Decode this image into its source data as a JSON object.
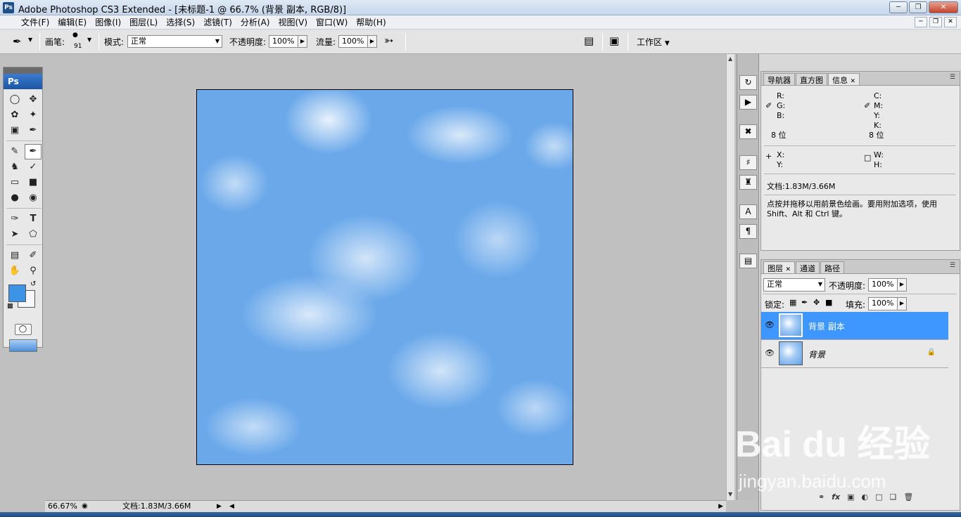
{
  "window": {
    "title": "Adobe Photoshop CS3 Extended - [未标题-1 @ 66.7% (背景 副本, RGB/8)]",
    "logo": "Ps"
  },
  "menu": {
    "items": [
      "文件(F)",
      "编辑(E)",
      "图像(I)",
      "图层(L)",
      "选择(S)",
      "滤镜(T)",
      "分析(A)",
      "视图(V)",
      "窗口(W)",
      "帮助(H)"
    ]
  },
  "options": {
    "brush_label": "画笔:",
    "brush_size": "91",
    "mode_label": "模式:",
    "mode_value": "正常",
    "opacity_label": "不透明度:",
    "opacity_value": "100%",
    "flow_label": "流量:",
    "flow_value": "100%",
    "workspace_label": "工作区"
  },
  "toolbox": {
    "logo": "Ps",
    "foreground_color": "#3e94e4",
    "background_color": "#f5f7fa"
  },
  "status": {
    "zoom": "66.67%",
    "doc_info": "文档:1.83M/3.66M"
  },
  "info_panel": {
    "tabs": [
      "导航器",
      "直方图",
      "信息"
    ],
    "active_tab": "信息",
    "r": "R:",
    "g": "G:",
    "b": "B:",
    "c": "C:",
    "m": "M:",
    "y": "Y:",
    "k": "K:",
    "bits_left": "8 位",
    "bits_right": "8 位",
    "x": "X:",
    "yy": "Y:",
    "w": "W:",
    "h": "H:",
    "doc": "文档:1.83M/3.66M",
    "hint": "点按并拖移以用前景色绘画。要用附加选项，使用 Shift、Alt 和 Ctrl 键。"
  },
  "layers_panel": {
    "tabs": [
      "图层",
      "通道",
      "路径"
    ],
    "active_tab": "图层",
    "blend_mode": "正常",
    "opacity_label": "不透明度:",
    "opacity_value": "100%",
    "lock_label": "锁定:",
    "fill_label": "填充:",
    "fill_value": "100%",
    "layers": [
      {
        "name": "背景 副本",
        "selected": true
      },
      {
        "name": "背景",
        "selected": false,
        "locked": true
      }
    ]
  },
  "watermark": {
    "text": "Bai du 经验",
    "url": "jingyan.baidu.com"
  }
}
